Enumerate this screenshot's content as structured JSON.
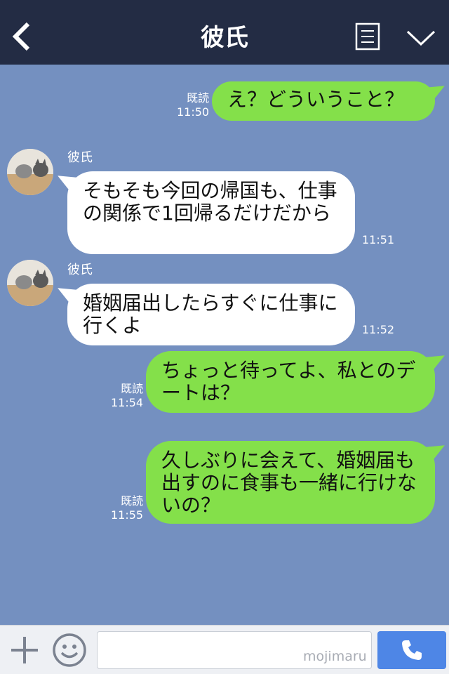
{
  "header": {
    "title": "彼氏",
    "back_icon": "chevron-left-icon",
    "notes_icon": "notes-icon",
    "menu_icon": "chevron-down-icon"
  },
  "messages": [
    {
      "side": "me",
      "text": "え？どういうこと？",
      "read": "既読",
      "time": "11:50"
    },
    {
      "side": "them",
      "sender": "彼氏",
      "text": "そもそも今回の帰国も、仕事の関係で1回帰るだけだから",
      "time": "11:51"
    },
    {
      "side": "them",
      "sender": "彼氏",
      "text": "婚姻届出したらすぐに仕事に行くよ",
      "time": "11:52"
    },
    {
      "side": "me",
      "text": "ちょっと待ってよ、私とのデートは？",
      "read": "既読",
      "time": "11:54"
    },
    {
      "side": "me",
      "text": "久しぶりに会えて、婚姻届も出すのに食事も一緒に行けないの？",
      "read": "既読",
      "time": "11:55"
    }
  ],
  "input": {
    "value": "",
    "watermark": "mojimaru"
  },
  "colors": {
    "header_bg": "#232c44",
    "chat_bg": "#7490c0",
    "my_bubble": "#84e04a",
    "their_bubble": "#ffffff",
    "call_button": "#4e86e6"
  }
}
